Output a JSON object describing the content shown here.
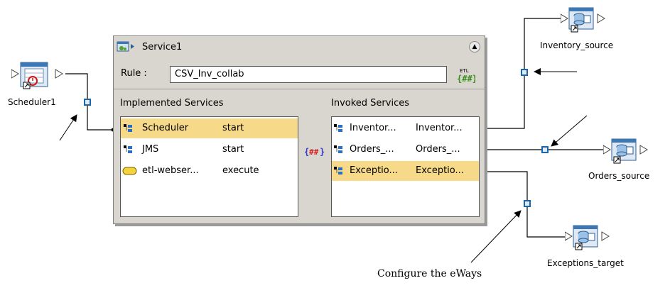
{
  "service": {
    "title": "Service1",
    "rule_label": "Rule :",
    "rule_value": "CSV_Inv_collab",
    "etl_icon_text": "ETL",
    "implemented_title": "Implemented Services",
    "invoked_title": "Invoked Services",
    "implemented": [
      {
        "name": "Scheduler",
        "op": "start",
        "icon": "tree-icon",
        "selected": true
      },
      {
        "name": "JMS",
        "op": "start",
        "icon": "tree-icon",
        "selected": false
      },
      {
        "name": "etl-webser...",
        "op": "execute",
        "icon": "pill-icon",
        "selected": false
      }
    ],
    "invoked": [
      {
        "name": "Inventor...",
        "op": "Inventor...",
        "selected": false
      },
      {
        "name": "Orders_...",
        "op": "Orders_...",
        "selected": false
      },
      {
        "name": "Exceptio...",
        "op": "Exceptio...",
        "selected": true
      }
    ]
  },
  "nodes": {
    "scheduler": "Scheduler1",
    "inventory": "Inventory_source",
    "orders": "Orders_source",
    "exceptions": "Exceptions_target"
  },
  "annotation": "Configure the eWays",
  "colors": {
    "connector": "#1b66a8",
    "selection": "#f7d98a",
    "panel": "#d9d6cf"
  }
}
